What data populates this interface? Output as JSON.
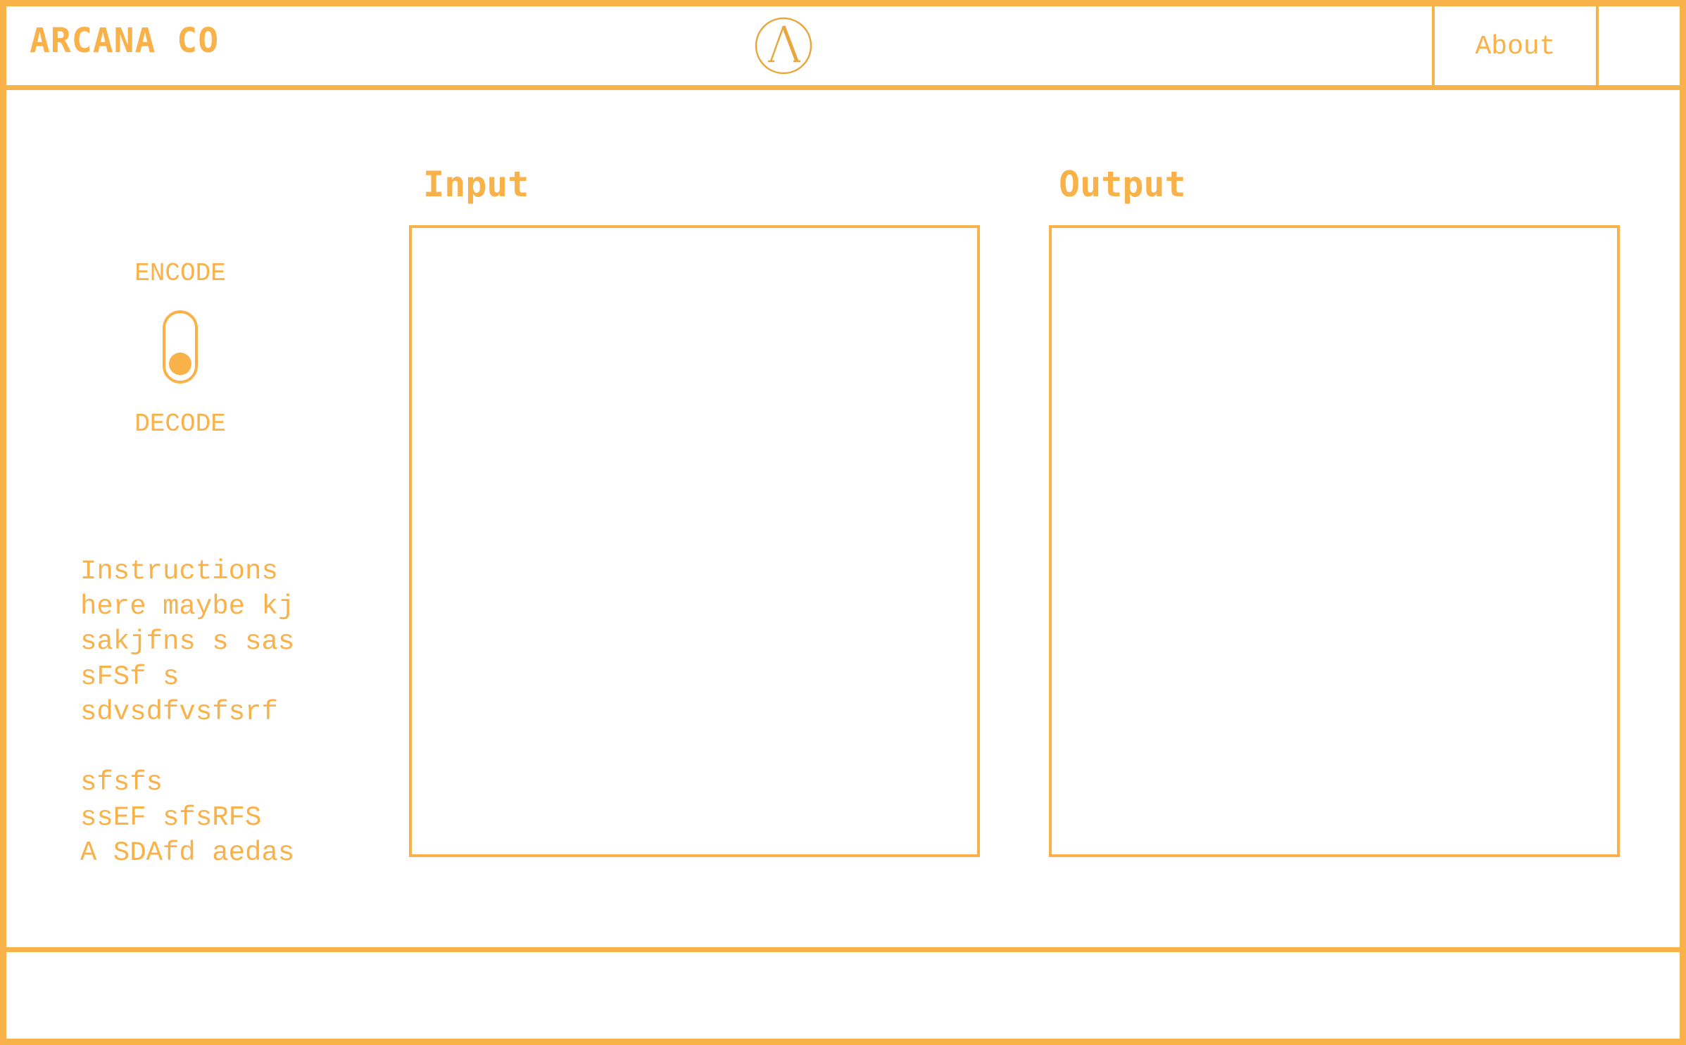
{
  "header": {
    "brand": "ARCANA CO",
    "logo_icon": "lambda-circle-logo-icon",
    "nav": {
      "about_label": "About"
    }
  },
  "toggle": {
    "top_label": "ENCODE",
    "bottom_label": "DECODE",
    "selected": "DECODE"
  },
  "instructions": {
    "text": "Instructions\nhere maybe kj\nsakjfns s sas\nsFSf s\nsdvsdfvsfsrf\n\nsfsfs\nssEF sfsRFS\nA SDAfd aedas"
  },
  "input_panel": {
    "title": "Input",
    "value": ""
  },
  "output_panel": {
    "title": "Output",
    "value": ""
  },
  "footer": {},
  "colors": {
    "accent": "#f9b24a",
    "background": "#ffffff"
  }
}
